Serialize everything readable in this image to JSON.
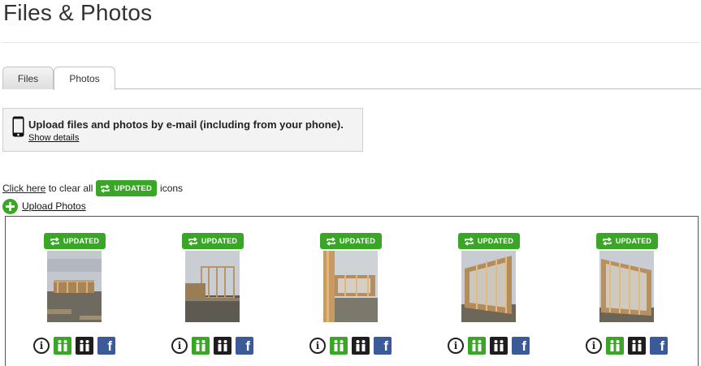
{
  "page": {
    "title": "Files & Photos"
  },
  "tabs": [
    {
      "label": "Files",
      "active": false
    },
    {
      "label": "Photos",
      "active": true
    }
  ],
  "email_upload": {
    "heading": "Upload files and photos by e-mail (including from your phone).",
    "details_link": "Show details",
    "icon": "phone-icon"
  },
  "clear_updated": {
    "link": "Click here",
    "text_before": "to clear all",
    "badge": "UPDATED",
    "text_after": "icons"
  },
  "upload_photos": {
    "label": "Upload Photos",
    "icon": "plus-circle-icon"
  },
  "colors": {
    "accent_green": "#3aa526",
    "facebook_blue": "#3b5a98"
  },
  "photos": [
    {
      "badge": "UPDATED",
      "actions": [
        "info-icon",
        "share-with-team-icon",
        "share-with-client-icon",
        "facebook-icon"
      ]
    },
    {
      "badge": "UPDATED",
      "actions": [
        "info-icon",
        "share-with-team-icon",
        "share-with-client-icon",
        "facebook-icon"
      ]
    },
    {
      "badge": "UPDATED",
      "actions": [
        "info-icon",
        "share-with-team-icon",
        "share-with-client-icon",
        "facebook-icon"
      ]
    },
    {
      "badge": "UPDATED",
      "actions": [
        "info-icon",
        "share-with-team-icon",
        "share-with-client-icon",
        "facebook-icon"
      ]
    },
    {
      "badge": "UPDATED",
      "actions": [
        "info-icon",
        "share-with-team-icon",
        "share-with-client-icon",
        "facebook-icon"
      ]
    }
  ]
}
